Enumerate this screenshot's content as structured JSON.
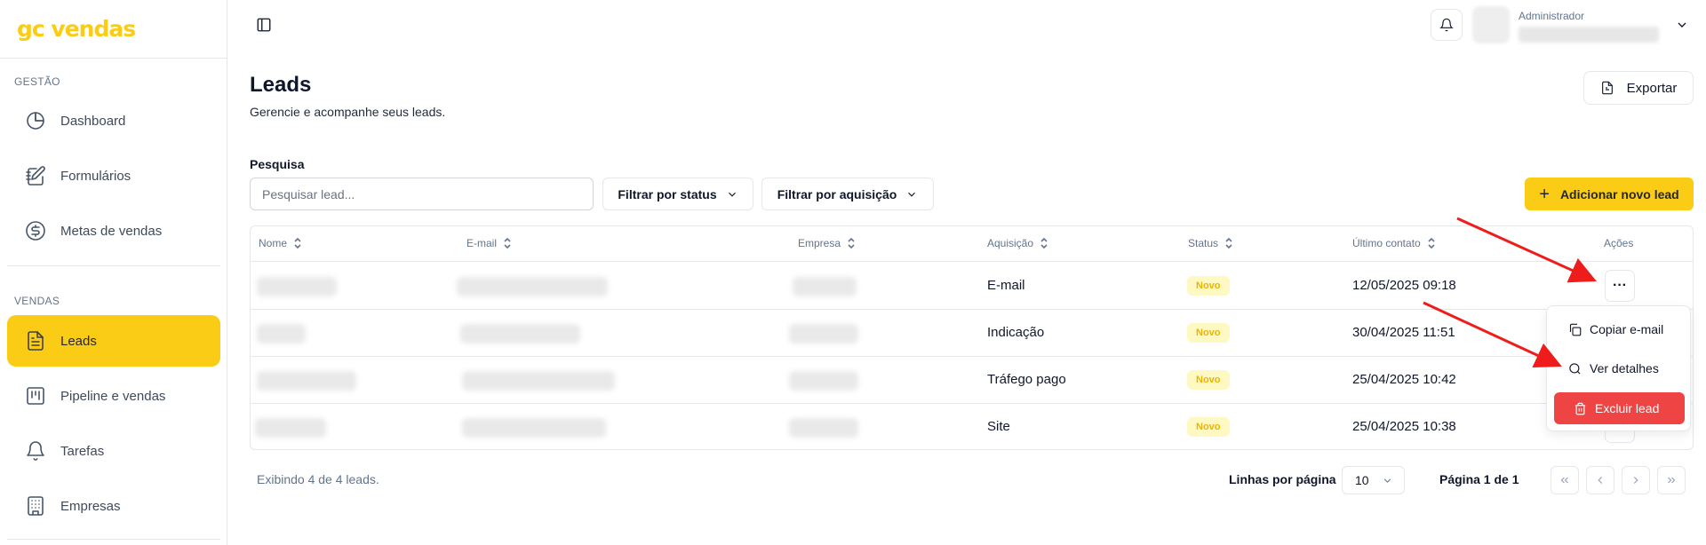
{
  "brand": {
    "logo": "gc vendas",
    "accent": "#facc15"
  },
  "sidebar": {
    "sections": [
      {
        "label": "GESTÃO"
      },
      {
        "label": "VENDAS"
      }
    ],
    "items": [
      {
        "label": "Dashboard",
        "icon": "pie-chart-icon"
      },
      {
        "label": "Formulários",
        "icon": "notebook-pen-icon"
      },
      {
        "label": "Metas de vendas",
        "icon": "dollar-circle-icon"
      },
      {
        "label": "Leads",
        "icon": "file-text-icon",
        "active": true
      },
      {
        "label": "Pipeline e vendas",
        "icon": "kanban-icon"
      },
      {
        "label": "Tarefas",
        "icon": "bell-icon"
      },
      {
        "label": "Empresas",
        "icon": "building-icon"
      }
    ]
  },
  "header": {
    "user_role": "Administrador"
  },
  "page": {
    "title": "Leads",
    "subtitle": "Gerencie e acompanhe seus leads.",
    "export_label": "Exportar"
  },
  "filters": {
    "search_label": "Pesquisa",
    "search_placeholder": "Pesquisar lead...",
    "search_value": "",
    "status_label": "Filtrar por status",
    "acquisition_label": "Filtrar por aquisição",
    "add_label": "Adicionar novo lead"
  },
  "table": {
    "columns": [
      "Nome",
      "E-mail",
      "Empresa",
      "Aquisição",
      "Status",
      "Último contato",
      "Ações"
    ],
    "rows": [
      {
        "acquisition": "E-mail",
        "status": "Novo",
        "last_contact": "12/05/2025 09:18"
      },
      {
        "acquisition": "Indicação",
        "status": "Novo",
        "last_contact": "30/04/2025 11:51"
      },
      {
        "acquisition": "Tráfego pago",
        "status": "Novo",
        "last_contact": "25/04/2025 10:42"
      },
      {
        "acquisition": "Site",
        "status": "Novo",
        "last_contact": "25/04/2025 10:38"
      }
    ],
    "actions_glyph": "···"
  },
  "menu": {
    "copy_email": "Copiar e-mail",
    "view_details": "Ver detalhes",
    "delete_lead": "Excluir lead",
    "danger_color": "#ef4444"
  },
  "footer": {
    "showing": "Exibindo 4 de 4 leads.",
    "rows_per_page_label": "Linhas por página",
    "rows_per_page_value": "10",
    "page_info": "Página 1 de 1"
  }
}
